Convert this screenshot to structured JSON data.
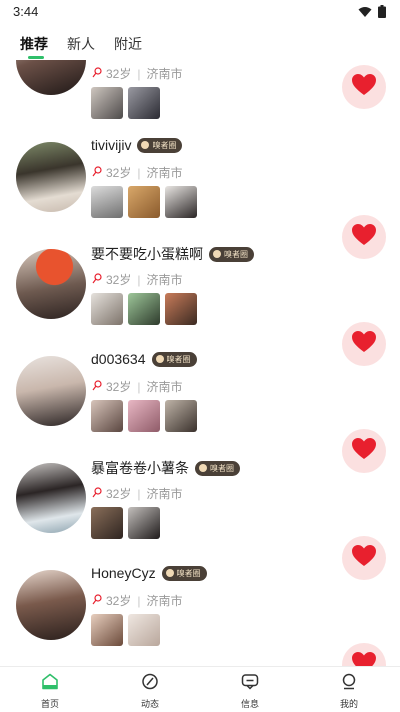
{
  "status": {
    "time": "3:44"
  },
  "tabs": [
    {
      "label": "推荐",
      "active": true
    },
    {
      "label": "新人",
      "active": false
    },
    {
      "label": "附近",
      "active": false
    }
  ],
  "colors": {
    "accent": "#2fbf6a",
    "like": "#e8202e",
    "like_bg": "#fbe0e0",
    "badge_bg": "#4a4037"
  },
  "users": [
    {
      "name": "",
      "badge": "",
      "age": "32岁",
      "city": "济南市",
      "photo_count": 2
    },
    {
      "name": "tivivijiv",
      "badge": "嗅者圈",
      "age": "32岁",
      "city": "济南市",
      "photo_count": 3
    },
    {
      "name": "要不要吃小蛋糕啊",
      "badge": "嗅者圈",
      "age": "32岁",
      "city": "济南市",
      "photo_count": 3
    },
    {
      "name": "d003634",
      "badge": "嗅者圈",
      "age": "32岁",
      "city": "济南市",
      "photo_count": 3
    },
    {
      "name": "暴富卷卷小薯条",
      "badge": "嗅者圈",
      "age": "32岁",
      "city": "济南市",
      "photo_count": 2
    },
    {
      "name": "HoneyCyz",
      "badge": "嗅者圈",
      "age": "32岁",
      "city": "济南市",
      "photo_count": 2
    }
  ],
  "nav": [
    {
      "label": "首页",
      "icon": "home-icon"
    },
    {
      "label": "动态",
      "icon": "moments-icon"
    },
    {
      "label": "信息",
      "icon": "message-icon"
    },
    {
      "label": "我的",
      "icon": "profile-icon"
    }
  ]
}
